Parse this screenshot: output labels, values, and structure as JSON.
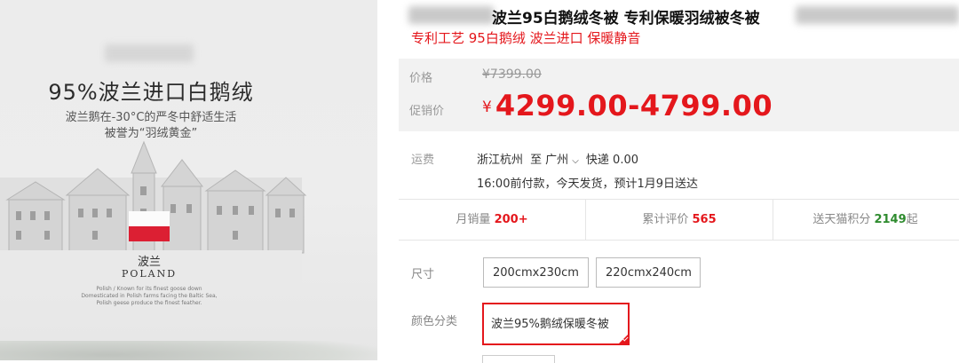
{
  "hero": {
    "title": "95%波兰进口白鹅绒",
    "sub1": "波兰鹅在-30°C的严冬中舒适生活",
    "sub2": "被誉为“羽绒黄金”",
    "country_cn": "波兰",
    "country_en": "POLAND",
    "note1": "Polish / Known for its finest goose down",
    "note2": "Domesticated in Polish farms facing the Baltic Sea,",
    "note3": "Polish geese produce the finest feather."
  },
  "product": {
    "title": "波兰95白鹅绒冬被 专利保暖羽绒被冬被",
    "subtitle": "专利工艺 95白鹅绒 波兰进口 保暖静音"
  },
  "price": {
    "label": "价格",
    "original": "¥7399.00",
    "promo_label": "促销价",
    "currency": "¥",
    "promo": "4299.00-4799.00"
  },
  "shipping": {
    "label": "运费",
    "from": "浙江杭州",
    "to_word": "至",
    "to": "广州",
    "method": "快递 0.00",
    "line2": "16:00前付款，今天发货，预计1月9日送达"
  },
  "stats": {
    "monthly_label": "月销量",
    "monthly_value": "200+",
    "reviews_label": "累计评价",
    "reviews_value": "565",
    "points_label": "送天猫积分",
    "points_value": "2149",
    "points_suffix": "起"
  },
  "options": {
    "size_label": "尺寸",
    "sizes": [
      "200cmx230cm",
      "220cmx240cm"
    ],
    "color_label": "颜色分类",
    "color_selected": "波兰95%鹅绒保暖冬被"
  },
  "colors": {
    "accent": "#e4171c",
    "points": "#2e8b2e",
    "price_bg": "#f2f2f2"
  }
}
